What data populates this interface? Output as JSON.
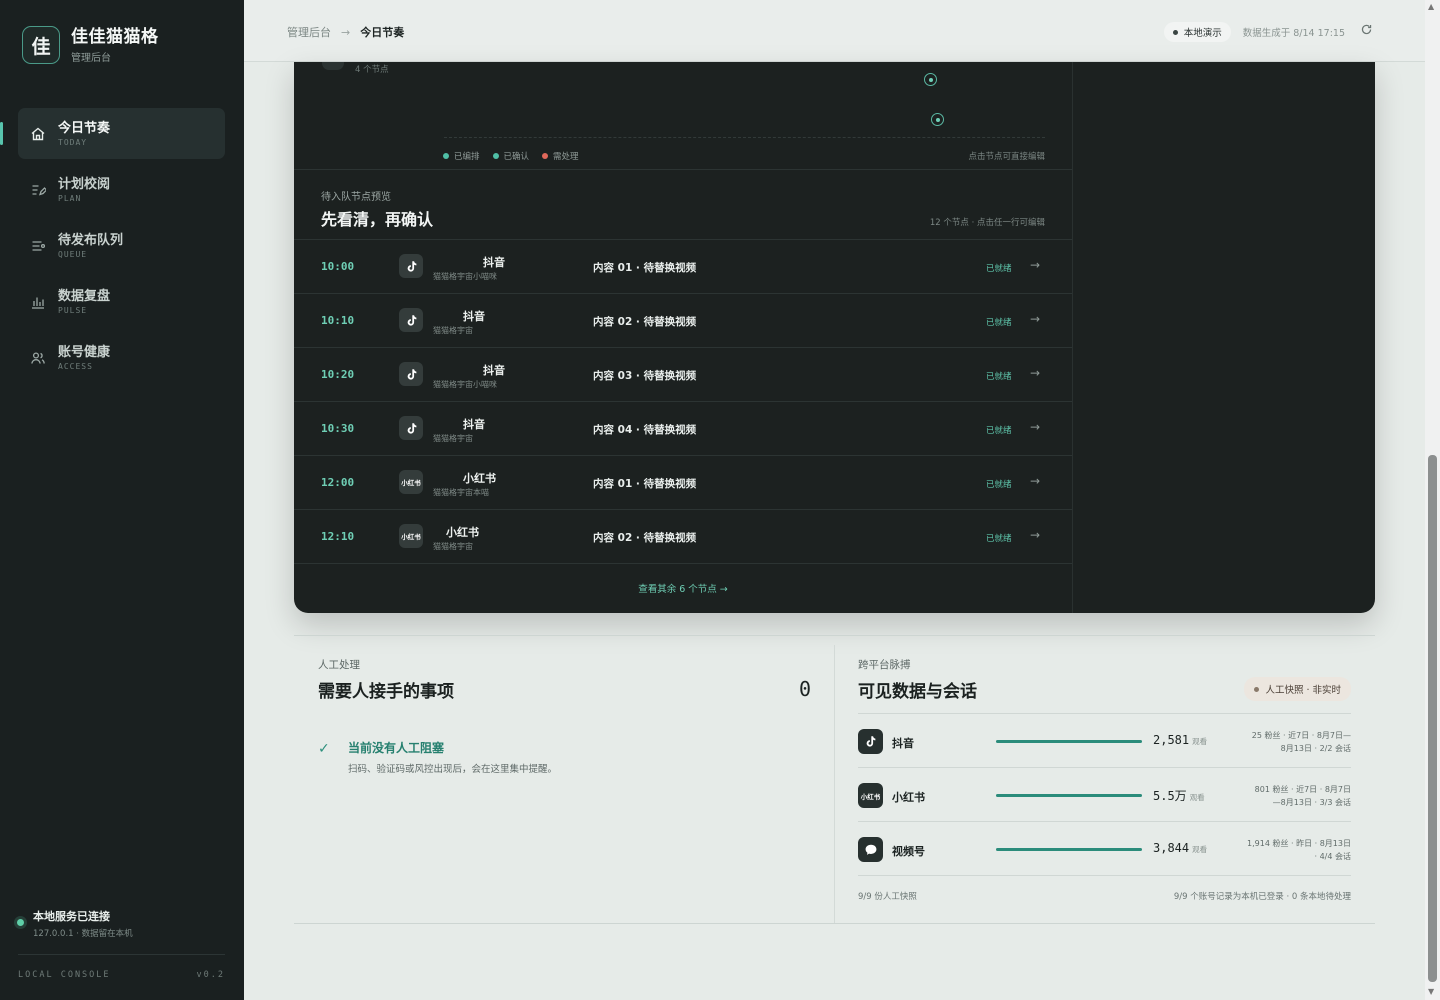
{
  "brand": {
    "logo_char": "佳",
    "title": "佳佳猫猫格",
    "subtitle": "管理后台"
  },
  "nav": [
    {
      "label": "今日节奏",
      "sub": "TODAY",
      "icon": "home-icon"
    },
    {
      "label": "计划校阅",
      "sub": "PLAN",
      "icon": "edit-list-icon"
    },
    {
      "label": "待发布队列",
      "sub": "QUEUE",
      "icon": "queue-icon"
    },
    {
      "label": "数据复盘",
      "sub": "PULSE",
      "icon": "bar-chart-icon"
    },
    {
      "label": "账号健康",
      "sub": "ACCESS",
      "icon": "users-icon"
    }
  ],
  "connection": {
    "title": "本地服务已连接",
    "sub": "127.0.0.1 · 数据留在本机"
  },
  "footer": {
    "left": "LOCAL CONSOLE",
    "right": "v0.2"
  },
  "topbar": {
    "crumb_root": "管理后台",
    "crumb_sep": "→",
    "crumb_current": "今日节奏",
    "mode_pill": "本地演示",
    "generated": "数据生成于 8/14 17:15"
  },
  "timeline": {
    "node_count": "4 个节点",
    "legend": [
      {
        "label": "已编排",
        "color": "#4fbfa6"
      },
      {
        "label": "已确认",
        "color": "#4fbfa6"
      },
      {
        "label": "需处理",
        "color": "#e0685a"
      }
    ],
    "hint": "点击节点可直接编辑"
  },
  "preview": {
    "kicker": "待入队节点预览",
    "title": "先看清，再确认",
    "meta": "12 个节点 · 点击任一行可编辑",
    "rows": [
      {
        "time": "10:00",
        "icon": "tiktok-icon",
        "platform": "抖音",
        "account": "猫猫格宇宙小喵咪",
        "content": "内容 01 · 待替换视频",
        "status": "已就绪"
      },
      {
        "time": "10:10",
        "icon": "tiktok-icon",
        "platform": "抖音",
        "account": "猫猫格宇宙",
        "content": "内容 02 · 待替换视频",
        "status": "已就绪"
      },
      {
        "time": "10:20",
        "icon": "tiktok-icon",
        "platform": "抖音",
        "account": "猫猫格宇宙小喵咪",
        "content": "内容 03 · 待替换视频",
        "status": "已就绪"
      },
      {
        "time": "10:30",
        "icon": "tiktok-icon",
        "platform": "抖音",
        "account": "猫猫格宇宙",
        "content": "内容 04 · 待替换视频",
        "status": "已就绪"
      },
      {
        "time": "12:00",
        "icon": "xiaohongshu-icon",
        "icon_text": "小红书",
        "platform": "小红书",
        "account": "猫猫格宇宙本喵",
        "content": "内容 01 · 待替换视频",
        "status": "已就绪"
      },
      {
        "time": "12:10",
        "icon": "xiaohongshu-icon",
        "icon_text": "小红书",
        "platform": "小红书",
        "account": "猫猫格宇宙",
        "content": "内容 02 · 待替换视频",
        "status": "已就绪"
      }
    ],
    "more": "查看其余 6 个节点 →"
  },
  "manual": {
    "kicker": "人工处理",
    "title": "需要人接手的事项",
    "count": "0",
    "ok_title": "当前没有人工阻塞",
    "ok_sub": "扫码、验证码或风控出现后，会在这里集中提醒。"
  },
  "pulse": {
    "kicker": "跨平台脉搏",
    "title": "可见数据与会话",
    "badge": "人工快照 · 非实时",
    "rows": [
      {
        "icon": "tiktok-icon",
        "name": "抖音",
        "value": "2,581",
        "unit": "观看",
        "meta_1": "25 粉丝 · 近7日 · 8月7日—",
        "meta_2": "8月13日 · 2/2 会话"
      },
      {
        "icon": "xiaohongshu-icon",
        "icon_text": "小红书",
        "name": "小红书",
        "value": "5.5万",
        "unit": "观看",
        "meta_1": "801 粉丝 · 近7日 · 8月7日",
        "meta_2": "—8月13日 · 3/3 会话"
      },
      {
        "icon": "wechat-channels-icon",
        "name": "视频号",
        "value": "3,844",
        "unit": "观看",
        "meta_1": "1,914 粉丝 · 昨日 · 8月13日",
        "meta_2": "· 4/4 会话"
      }
    ],
    "foot_left": "9/9 份人工快照",
    "foot_right": "9/9 个账号记录为本机已登录 · 0 条本地待处理"
  }
}
